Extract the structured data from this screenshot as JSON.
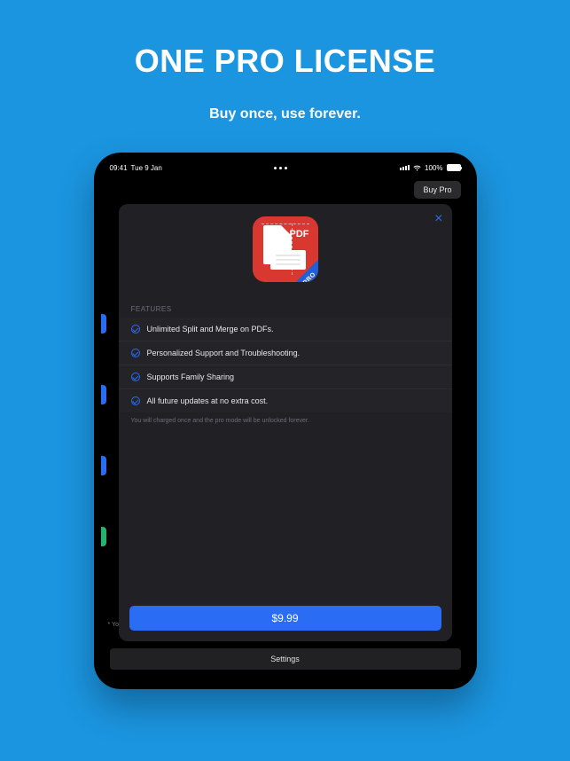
{
  "headline": "ONE PRO LICENSE",
  "tagline": "Buy once, use forever.",
  "statusbar": {
    "time": "09:41",
    "date": "Tue 9 Jan",
    "battery": "100%"
  },
  "nav": {
    "buy_pro": "Buy Pro",
    "settings": "Settings",
    "footer_leak": "*  Yo"
  },
  "modal": {
    "icon_label": "PDF",
    "ribbon": "PRO",
    "section_label": "FEATURES",
    "features": [
      "Unlimited Split and Merge on PDFs.",
      "Personalized Support and Troubleshooting.",
      "Supports Family Sharing",
      "All future updates at no extra cost."
    ],
    "disclaimer": "You will charged once and the pro mode will be unlocked forever.",
    "price": "$9.99"
  }
}
